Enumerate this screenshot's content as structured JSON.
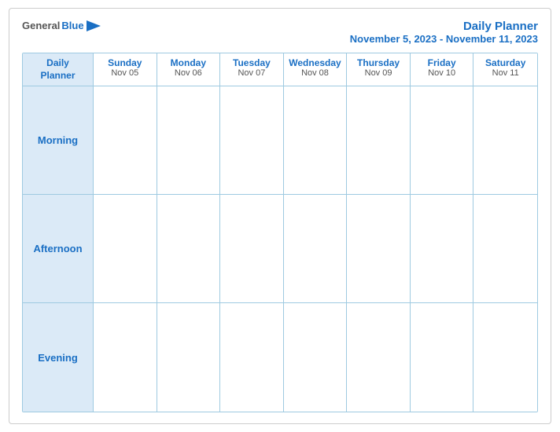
{
  "logo": {
    "general": "General",
    "blue": "Blue"
  },
  "title": {
    "main": "Daily Planner",
    "date_range": "November 5, 2023 - November 11, 2023"
  },
  "header_first": {
    "line1": "Daily",
    "line2": "Planner"
  },
  "days": [
    {
      "name": "Sunday",
      "date": "Nov 05"
    },
    {
      "name": "Monday",
      "date": "Nov 06"
    },
    {
      "name": "Tuesday",
      "date": "Nov 07"
    },
    {
      "name": "Wednesday",
      "date": "Nov 08"
    },
    {
      "name": "Thursday",
      "date": "Nov 09"
    },
    {
      "name": "Friday",
      "date": "Nov 10"
    },
    {
      "name": "Saturday",
      "date": "Nov 11"
    }
  ],
  "rows": [
    {
      "label": "Morning"
    },
    {
      "label": "Afternoon"
    },
    {
      "label": "Evening"
    }
  ]
}
